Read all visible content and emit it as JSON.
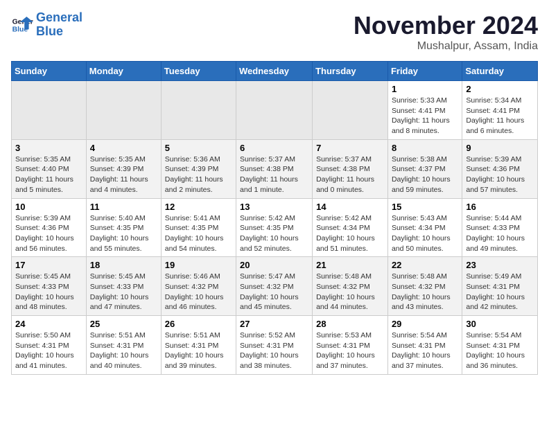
{
  "logo": {
    "line1": "General",
    "line2": "Blue"
  },
  "title": "November 2024",
  "location": "Mushalpur, Assam, India",
  "weekdays": [
    "Sunday",
    "Monday",
    "Tuesday",
    "Wednesday",
    "Thursday",
    "Friday",
    "Saturday"
  ],
  "weeks": [
    [
      {
        "day": "",
        "info": ""
      },
      {
        "day": "",
        "info": ""
      },
      {
        "day": "",
        "info": ""
      },
      {
        "day": "",
        "info": ""
      },
      {
        "day": "",
        "info": ""
      },
      {
        "day": "1",
        "info": "Sunrise: 5:33 AM\nSunset: 4:41 PM\nDaylight: 11 hours and 8 minutes."
      },
      {
        "day": "2",
        "info": "Sunrise: 5:34 AM\nSunset: 4:41 PM\nDaylight: 11 hours and 6 minutes."
      }
    ],
    [
      {
        "day": "3",
        "info": "Sunrise: 5:35 AM\nSunset: 4:40 PM\nDaylight: 11 hours and 5 minutes."
      },
      {
        "day": "4",
        "info": "Sunrise: 5:35 AM\nSunset: 4:39 PM\nDaylight: 11 hours and 4 minutes."
      },
      {
        "day": "5",
        "info": "Sunrise: 5:36 AM\nSunset: 4:39 PM\nDaylight: 11 hours and 2 minutes."
      },
      {
        "day": "6",
        "info": "Sunrise: 5:37 AM\nSunset: 4:38 PM\nDaylight: 11 hours and 1 minute."
      },
      {
        "day": "7",
        "info": "Sunrise: 5:37 AM\nSunset: 4:38 PM\nDaylight: 11 hours and 0 minutes."
      },
      {
        "day": "8",
        "info": "Sunrise: 5:38 AM\nSunset: 4:37 PM\nDaylight: 10 hours and 59 minutes."
      },
      {
        "day": "9",
        "info": "Sunrise: 5:39 AM\nSunset: 4:36 PM\nDaylight: 10 hours and 57 minutes."
      }
    ],
    [
      {
        "day": "10",
        "info": "Sunrise: 5:39 AM\nSunset: 4:36 PM\nDaylight: 10 hours and 56 minutes."
      },
      {
        "day": "11",
        "info": "Sunrise: 5:40 AM\nSunset: 4:35 PM\nDaylight: 10 hours and 55 minutes."
      },
      {
        "day": "12",
        "info": "Sunrise: 5:41 AM\nSunset: 4:35 PM\nDaylight: 10 hours and 54 minutes."
      },
      {
        "day": "13",
        "info": "Sunrise: 5:42 AM\nSunset: 4:35 PM\nDaylight: 10 hours and 52 minutes."
      },
      {
        "day": "14",
        "info": "Sunrise: 5:42 AM\nSunset: 4:34 PM\nDaylight: 10 hours and 51 minutes."
      },
      {
        "day": "15",
        "info": "Sunrise: 5:43 AM\nSunset: 4:34 PM\nDaylight: 10 hours and 50 minutes."
      },
      {
        "day": "16",
        "info": "Sunrise: 5:44 AM\nSunset: 4:33 PM\nDaylight: 10 hours and 49 minutes."
      }
    ],
    [
      {
        "day": "17",
        "info": "Sunrise: 5:45 AM\nSunset: 4:33 PM\nDaylight: 10 hours and 48 minutes."
      },
      {
        "day": "18",
        "info": "Sunrise: 5:45 AM\nSunset: 4:33 PM\nDaylight: 10 hours and 47 minutes."
      },
      {
        "day": "19",
        "info": "Sunrise: 5:46 AM\nSunset: 4:32 PM\nDaylight: 10 hours and 46 minutes."
      },
      {
        "day": "20",
        "info": "Sunrise: 5:47 AM\nSunset: 4:32 PM\nDaylight: 10 hours and 45 minutes."
      },
      {
        "day": "21",
        "info": "Sunrise: 5:48 AM\nSunset: 4:32 PM\nDaylight: 10 hours and 44 minutes."
      },
      {
        "day": "22",
        "info": "Sunrise: 5:48 AM\nSunset: 4:32 PM\nDaylight: 10 hours and 43 minutes."
      },
      {
        "day": "23",
        "info": "Sunrise: 5:49 AM\nSunset: 4:31 PM\nDaylight: 10 hours and 42 minutes."
      }
    ],
    [
      {
        "day": "24",
        "info": "Sunrise: 5:50 AM\nSunset: 4:31 PM\nDaylight: 10 hours and 41 minutes."
      },
      {
        "day": "25",
        "info": "Sunrise: 5:51 AM\nSunset: 4:31 PM\nDaylight: 10 hours and 40 minutes."
      },
      {
        "day": "26",
        "info": "Sunrise: 5:51 AM\nSunset: 4:31 PM\nDaylight: 10 hours and 39 minutes."
      },
      {
        "day": "27",
        "info": "Sunrise: 5:52 AM\nSunset: 4:31 PM\nDaylight: 10 hours and 38 minutes."
      },
      {
        "day": "28",
        "info": "Sunrise: 5:53 AM\nSunset: 4:31 PM\nDaylight: 10 hours and 37 minutes."
      },
      {
        "day": "29",
        "info": "Sunrise: 5:54 AM\nSunset: 4:31 PM\nDaylight: 10 hours and 37 minutes."
      },
      {
        "day": "30",
        "info": "Sunrise: 5:54 AM\nSunset: 4:31 PM\nDaylight: 10 hours and 36 minutes."
      }
    ]
  ]
}
